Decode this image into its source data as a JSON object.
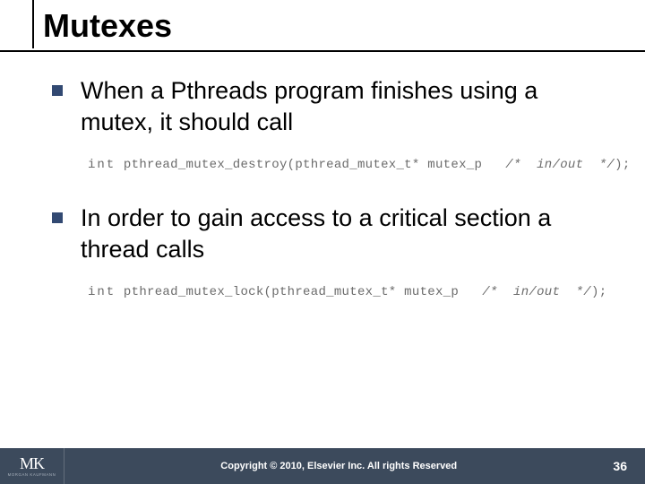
{
  "slide": {
    "title": "Mutexes",
    "bullets": [
      "When a Pthreads program finishes using a mutex, it should call",
      "In order to gain access to a critical section a thread calls"
    ],
    "code": [
      {
        "kw": "int",
        "call": " pthread_mutex_destroy(pthread_mutex_t* mutex_p   ",
        "comment": "/*  in/out  */",
        "tail": ");"
      },
      {
        "kw": "int",
        "call": " pthread_mutex_lock(pthread_mutex_t* mutex_p   ",
        "comment": "/*  in/out  */",
        "tail": ");"
      }
    ]
  },
  "footer": {
    "logo_main": "MK",
    "logo_sub": "MORGAN KAUFMANN",
    "copyright": "Copyright © 2010, Elsevier Inc. All rights Reserved",
    "page": "36"
  }
}
